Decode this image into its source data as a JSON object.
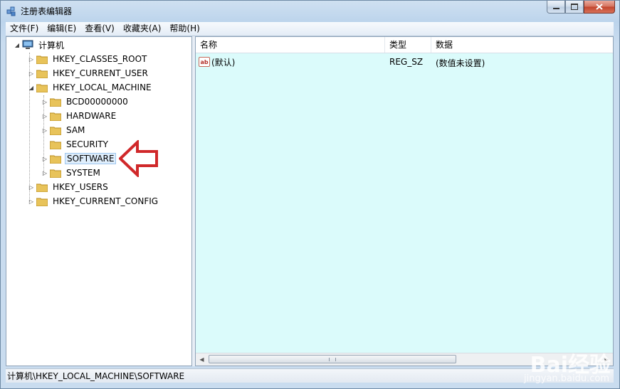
{
  "window": {
    "title": "注册表编辑器"
  },
  "menu": [
    {
      "label": "文件(F)"
    },
    {
      "label": "编辑(E)"
    },
    {
      "label": "查看(V)"
    },
    {
      "label": "收藏夹(A)"
    },
    {
      "label": "帮助(H)"
    }
  ],
  "tree": {
    "root": "计算机",
    "hkcr": "HKEY_CLASSES_ROOT",
    "hkcu": "HKEY_CURRENT_USER",
    "hklm": "HKEY_LOCAL_MACHINE",
    "bcd": "BCD00000000",
    "hardware": "HARDWARE",
    "sam": "SAM",
    "security": "SECURITY",
    "software": "SOFTWARE",
    "system": "SYSTEM",
    "hku": "HKEY_USERS",
    "hkcc": "HKEY_CURRENT_CONFIG"
  },
  "list": {
    "columns": [
      "名称",
      "类型",
      "数据"
    ],
    "rows": [
      {
        "name": "(默认)",
        "type": "REG_SZ",
        "data": "(数值未设置)",
        "icon": "string-value-icon"
      }
    ]
  },
  "status": {
    "path": "计算机\\HKEY_LOCAL_MACHINE\\SOFTWARE"
  },
  "watermark": {
    "brand": "Bai经验",
    "url": "jingyan.baidu.com"
  },
  "colors": {
    "list_background": "#dbfbfb",
    "annotation_arrow": "#d0282a"
  }
}
